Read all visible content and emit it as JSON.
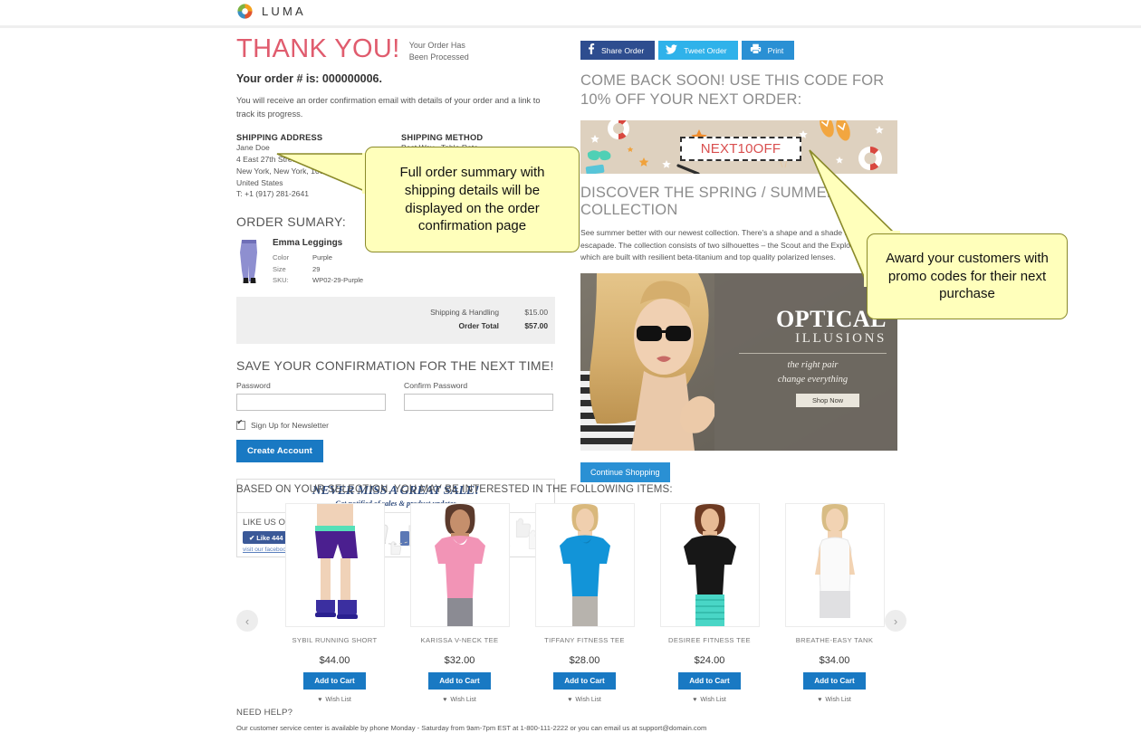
{
  "header": {
    "brand": "LUMA",
    "logo_icon": "luma-ring-logo"
  },
  "confirmation": {
    "heading": "THANK YOU!",
    "subheading_line1": "Your Order Has",
    "subheading_line2": "Been Processed",
    "order_number_text": "Your order # is: 000000006.",
    "note": "You will receive an order confirmation email with details of your order and a link to track its progress.",
    "shipping_address_label": "SHIPPING ADDRESS",
    "shipping_address": {
      "name": "Jane Doe",
      "street": "4 East 27th Street",
      "city_state_zip": "New York, New York, 10001",
      "country": "United States",
      "phone": "T: +1 (917) 281-2641"
    },
    "shipping_method_label": "SHIPPING METHOD",
    "shipping_method": "Best Way - Table Rate"
  },
  "order_summary": {
    "title": "ORDER SUMARY:",
    "item": {
      "name": "Emma Leggings",
      "thumb_icon": "purple-leggings-thumb",
      "attributes": [
        {
          "key": "Color",
          "value": "Purple"
        },
        {
          "key": "Size",
          "value": "29"
        },
        {
          "key": "SKU:",
          "value": "WP02-29-Purple"
        }
      ]
    },
    "totals": [
      {
        "label": "Shipping & Handling",
        "value": "$15.00",
        "bold": false
      },
      {
        "label": "Order Total",
        "value": "$57.00",
        "bold": true
      }
    ]
  },
  "save_confirmation": {
    "title": "SAVE YOUR CONFIRMATION FOR THE NEXT TIME!",
    "password_label": "Password",
    "password_value": "",
    "confirm_label": "Confirm Password",
    "confirm_value": "",
    "newsletter_label": "Sign Up for Newsletter",
    "newsletter_checked": true,
    "create_account_label": "Create Account"
  },
  "facebook_promo": {
    "headline": "NEVER MISS A GREAT SALE!",
    "subhead": "Get notified of  sales & product updates",
    "like_us_label": "LIKE US ON FACEBOOK",
    "like_button_label": "Like 444",
    "like_check_glyph": "✔",
    "page_link_label": "visit our facebook page"
  },
  "social_buttons": [
    {
      "label": "Share Order",
      "icon": "facebook-icon",
      "glyph": "f",
      "color": "#2e4d8f",
      "key": "fb"
    },
    {
      "label": "Tweet Order",
      "icon": "twitter-bird-icon",
      "glyph": "🐦",
      "color": "#2fb2ea",
      "key": "tw"
    },
    {
      "label": "Print",
      "icon": "printer-icon",
      "glyph": "🖶",
      "color": "#2a90d4",
      "key": "pr"
    }
  ],
  "promo": {
    "heading": "COME BACK SOON! USE THIS CODE FOR 10% OFF YOUR NEXT ORDER:",
    "code": "NEXT10OFF",
    "banner_icon": "summer-beach-pattern-banner"
  },
  "discover": {
    "heading": "DISCOVER THE SPRING / SUMMER COLLECTION",
    "body": "See summer better with our newest collection. There's a shape and a shade for every escapade. The collection consists of two silhouettes – the Scout and the Explorer – both of which are built with resilient beta-titanium and top quality polarized lenses.",
    "hero": {
      "image_icon": "woman-sunglasses-photo",
      "title": "OPTICAL",
      "subtitle": "ILLUSIONS",
      "tagline_line1": "the right pair",
      "tagline_line2": "change everything",
      "cta_label": "Shop Now"
    },
    "continue_shopping_label": "Continue Shopping"
  },
  "carousel": {
    "title": "BASED ON YOUR SELECTION, YOU MAY BE INTERESTED IN THE FOLLOWING ITEMS:",
    "prev_icon": "chevron-left-icon",
    "next_icon": "chevron-right-icon",
    "add_to_cart_label": "Add to Cart",
    "wish_list_label": "Wish List",
    "wish_icon": "heart-icon",
    "products": [
      {
        "name": "SYBIL RUNNING SHORT",
        "price": "$44.00",
        "image_icon": "purple-running-shorts-photo"
      },
      {
        "name": "KARISSA V-NECK TEE",
        "price": "$32.00",
        "image_icon": "pink-vneck-tee-photo"
      },
      {
        "name": "TIFFANY FITNESS TEE",
        "price": "$28.00",
        "image_icon": "blue-fitness-tee-photo"
      },
      {
        "name": "DESIREE FITNESS TEE",
        "price": "$24.00",
        "image_icon": "black-fitness-tee-photo"
      },
      {
        "name": "BREATHE-EASY TANK",
        "price": "$34.00",
        "image_icon": "white-tank-photo"
      }
    ]
  },
  "need_help": {
    "title": "NEED HELP?",
    "body": "Our customer service center is available by phone Monday - Saturday from 9am-7pm EST at 1-800-111-2222 or you can email us at support@domain.com"
  },
  "callouts": [
    {
      "id": "order",
      "text": "Full order summary with shipping details will be displayed on the order confirmation page"
    },
    {
      "id": "promo",
      "text": "Award your customers with promo codes for their next purchase"
    }
  ],
  "colors": {
    "accent_blue": "#1979c3",
    "link_blue": "#2a90d4",
    "thankyou_pink": "#e05c6e",
    "facebook_blue": "#2e4d8f",
    "twitter_blue": "#2fb2ea",
    "callout_yellow": "#ffffbb",
    "promo_code_red": "#d94f4f"
  }
}
